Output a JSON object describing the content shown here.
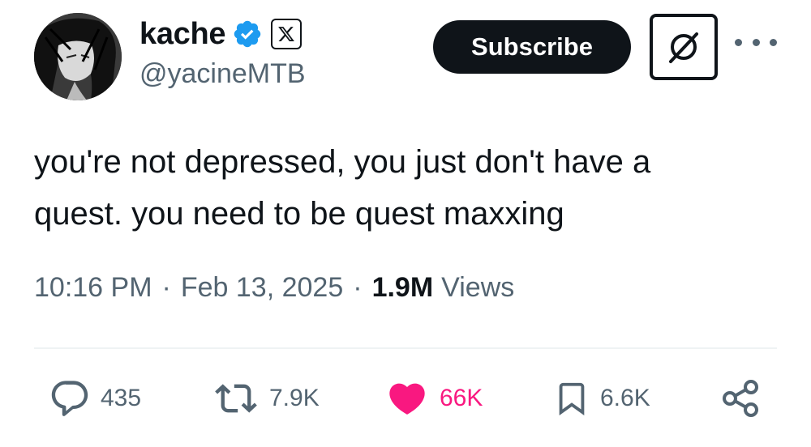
{
  "author": {
    "name": "kache",
    "handle": "@yacineMTB",
    "badge_icon": "x-logo-icon"
  },
  "header": {
    "subscribe_label": "Subscribe",
    "grok_icon": "grok-icon",
    "more_icon": "more-icon"
  },
  "tweet": {
    "text": "you're not depressed, you just don't have a\nquest. you need to be quest maxxing",
    "time": "10:16 PM",
    "separator": "·",
    "date": "Feb 13, 2025",
    "views_count": "1.9M",
    "views_label": "Views"
  },
  "actions": {
    "replies": "435",
    "reposts": "7.9K",
    "likes": "66K",
    "bookmarks": "6.6K"
  },
  "colors": {
    "verified": "#1d9bf0",
    "like": "#f91880",
    "muted": "#536471",
    "text": "#0f1419"
  }
}
